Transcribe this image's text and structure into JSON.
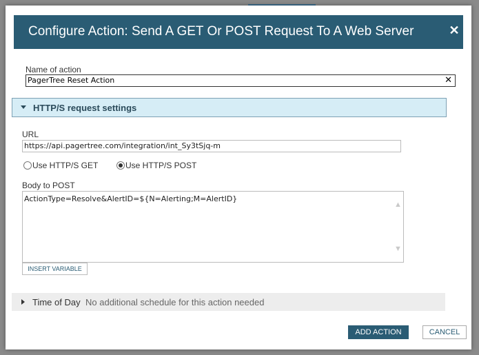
{
  "dialog": {
    "title": "Configure Action: Send A GET Or POST Request To A Web Server",
    "close_icon": "close-icon"
  },
  "name_field": {
    "label": "Name of action",
    "value": "PagerTree Reset Action",
    "clear_icon": "clear-icon"
  },
  "http_section": {
    "title": "HTTP/S request settings",
    "expanded": true,
    "url_label": "URL",
    "url_value": "https://api.pagertree.com/integration/int_Sy3tSjq-m",
    "method_options": [
      {
        "label": "Use HTTP/S GET",
        "selected": false
      },
      {
        "label": "Use HTTP/S POST",
        "selected": true
      }
    ],
    "body_label": "Body to POST",
    "body_value": "ActionType=Resolve&AlertID=${N=Alerting;M=AlertID}",
    "insert_variable_label": "INSERT VARIABLE"
  },
  "time_of_day": {
    "title": "Time of Day",
    "description": "No additional schedule for this action needed",
    "expanded": false
  },
  "footer": {
    "add_label": "ADD ACTION",
    "cancel_label": "CANCEL"
  },
  "colors": {
    "header": "#2a5c74",
    "section_bg": "#d6edf6",
    "primary_button": "#2a5c74"
  }
}
